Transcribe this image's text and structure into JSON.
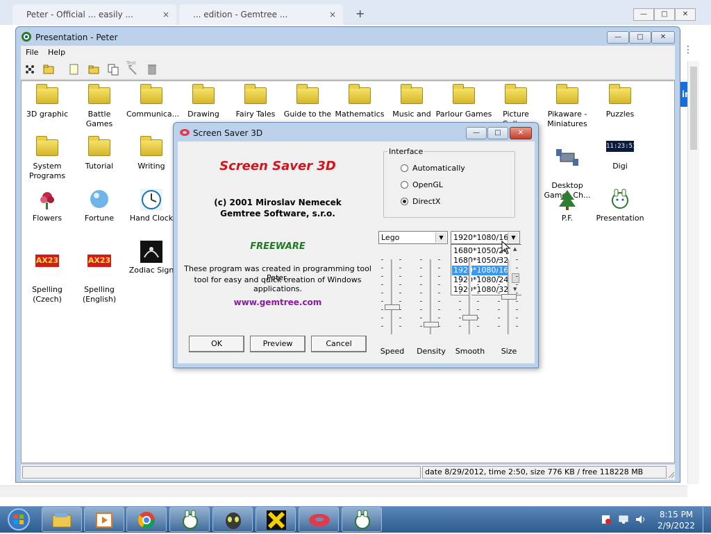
{
  "background_browser": {
    "tabs": [
      {
        "label": "Peter - Official ... easily ...",
        "close": "×"
      },
      {
        "label": "... edition - Gemtree ...",
        "close": "×"
      }
    ],
    "new_tab": "+",
    "controls": {
      "minimize": "—",
      "maximize": "□",
      "close": "✕"
    },
    "partial_button": "in"
  },
  "window": {
    "title": "Presentation - Peter",
    "controls": {
      "minimize": "—",
      "maximize": "□",
      "close": "✕"
    },
    "menu": [
      {
        "label": "File"
      },
      {
        "label": "Help"
      }
    ],
    "toolbar": [
      {
        "icon": "new-program-icon"
      },
      {
        "icon": "open-folder-icon"
      },
      {
        "icon": "new-item-icon"
      },
      {
        "icon": "new-group-icon"
      },
      {
        "icon": "copy-icon"
      },
      {
        "icon": "test-icon",
        "label": "Test"
      },
      {
        "icon": "delete-icon"
      }
    ],
    "icons": [
      {
        "label": "3D graphic",
        "type": "folder"
      },
      {
        "label": "Battle Games",
        "type": "folder"
      },
      {
        "label": "Communica...",
        "type": "folder"
      },
      {
        "label": "Drawing",
        "type": "folder"
      },
      {
        "label": "Fairy Tales",
        "type": "folder"
      },
      {
        "label": "Guide to the",
        "type": "folder"
      },
      {
        "label": "Mathematics",
        "type": "folder"
      },
      {
        "label": "Music and",
        "type": "folder"
      },
      {
        "label": "Parlour Games",
        "type": "folder"
      },
      {
        "label": "Picture Gallery",
        "type": "folder"
      },
      {
        "label": "Pikaware -\nMiniatures",
        "type": "folder"
      },
      {
        "label": "Puzzles",
        "type": "folder"
      },
      {
        "label": "System\nPrograms",
        "type": "folder"
      },
      {
        "label": "Tutorial",
        "type": "folder"
      },
      {
        "label": "Writing",
        "type": "folder"
      },
      {
        "label": "Desktop\nGames Ch...",
        "type": "app"
      },
      {
        "label": "Digi",
        "type": "app"
      },
      {
        "label": "Flowers",
        "type": "app"
      },
      {
        "label": "Fortune",
        "type": "app"
      },
      {
        "label": "Hand Clock",
        "type": "app"
      },
      {
        "label": "P.F.",
        "type": "app"
      },
      {
        "label": "Presentation",
        "type": "app"
      },
      {
        "label": "Spelling\n(Czech)",
        "type": "app"
      },
      {
        "label": "Spelling\n(English)",
        "type": "app"
      },
      {
        "label": "Zodiac Sign",
        "type": "app"
      }
    ],
    "digi_clock_text": "11:23:51",
    "ax_badge": "AX23",
    "status": "date 8/29/2012, time 2:50, size 776 KB / free 118228 MB"
  },
  "dialog": {
    "title": "Screen Saver 3D",
    "controls": {
      "minimize": "—",
      "maximize": "□",
      "close": "✕"
    },
    "heading": "Screen Saver 3D",
    "copyright_line1": "(c) 2001 Miroslav Nemecek",
    "copyright_line2": "Gemtree Software, s.r.o.",
    "freeware": "FREEWARE",
    "description_line1": "These program was created in programming tool Peter,",
    "description_line2": "tool for easy and quick creation of Windows applications.",
    "url": "www.gemtree.com",
    "buttons": {
      "ok": "OK",
      "preview": "Preview",
      "cancel": "Cancel"
    },
    "interface": {
      "label": "Interface",
      "options": [
        {
          "label": "Automatically",
          "selected": false
        },
        {
          "label": "OpenGL",
          "selected": false
        },
        {
          "label": "DirectX",
          "selected": true
        }
      ]
    },
    "scene_combo": {
      "value": "Lego"
    },
    "resolution_combo": {
      "value": "1920*1080/16",
      "open": true,
      "visible_options": [
        "1680*1050/24",
        "1680*1050/32",
        "1920*1080/16",
        "1920*1080/24",
        "1920*1080/32"
      ],
      "highlighted_index": 2
    },
    "sliders": [
      {
        "label": "Speed",
        "level": 0.35
      },
      {
        "label": "Density",
        "level": 0.1
      },
      {
        "label": "Smooth",
        "level": 0.2
      },
      {
        "label": "Size",
        "level": 0.5
      }
    ]
  },
  "taskbar": {
    "apps": [
      {
        "icon": "explorer-icon"
      },
      {
        "icon": "media-player-icon"
      },
      {
        "icon": "chrome-icon"
      },
      {
        "icon": "peter-icon"
      },
      {
        "icon": "alien-icon"
      },
      {
        "icon": "cross-app-icon"
      },
      {
        "icon": "donut-icon"
      },
      {
        "icon": "peter-icon-2"
      }
    ],
    "clock": {
      "time": "8:15 PM",
      "date": "2/9/2022"
    }
  }
}
